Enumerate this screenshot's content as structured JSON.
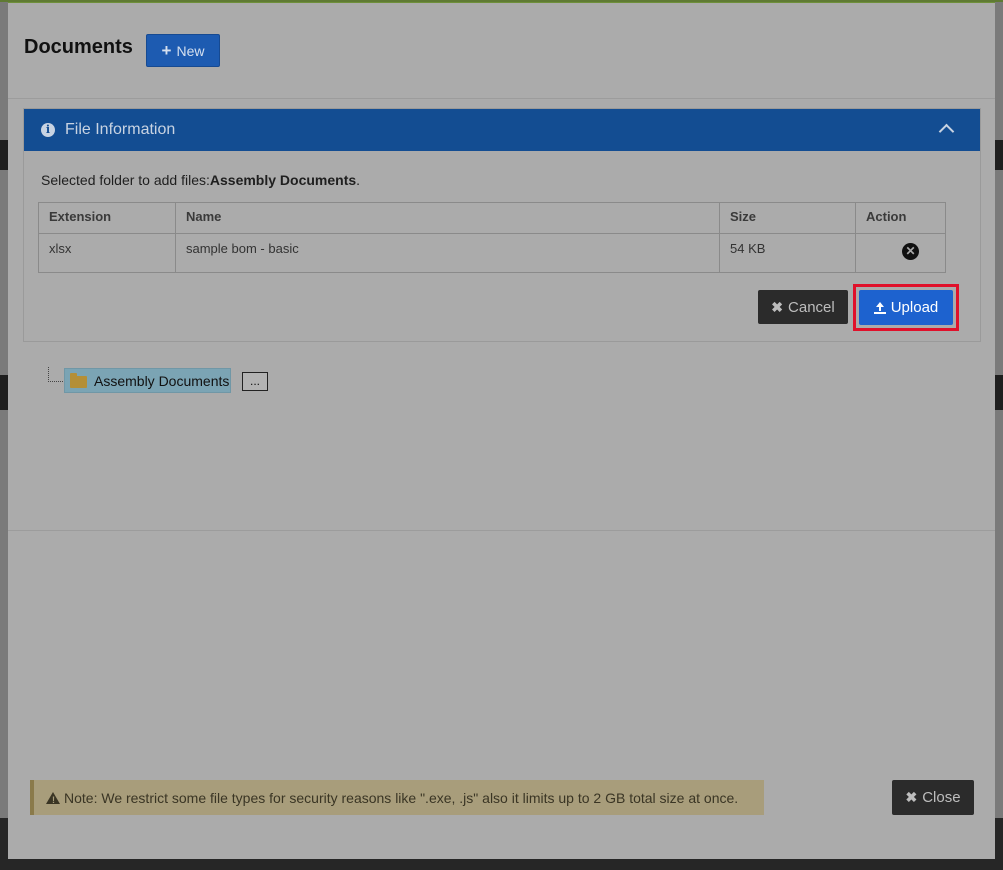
{
  "modal": {
    "title": "Documents",
    "new_button": "New"
  },
  "file_panel": {
    "heading": "File Information",
    "selected_folder_prefix": "Selected folder to add files:",
    "selected_folder_name": "Assembly Documents",
    "selected_folder_suffix": ".",
    "columns": [
      "Extension",
      "Name",
      "Size",
      "Action"
    ],
    "rows": [
      {
        "extension": "xlsx",
        "name": "sample bom - basic",
        "size": "54 KB"
      }
    ],
    "cancel_button": "Cancel",
    "upload_button": "Upload"
  },
  "tree": {
    "node_label": "Assembly Documents",
    "more_button": "..."
  },
  "footer": {
    "note": "Note: We restrict some file types for security reasons like \".exe, .js\" also it limits up to 2 GB total size at once.",
    "close_button": "Close"
  },
  "colors": {
    "header_blue": "#134d92",
    "primary_blue": "#1d62cf",
    "highlight_red": "#e0102a",
    "dark_button": "#2b2b2b"
  },
  "icons": [
    "plus-icon",
    "info-icon",
    "chevron-up-icon",
    "remove-icon",
    "times-icon",
    "upload-icon",
    "folder-icon",
    "warning-icon"
  ]
}
